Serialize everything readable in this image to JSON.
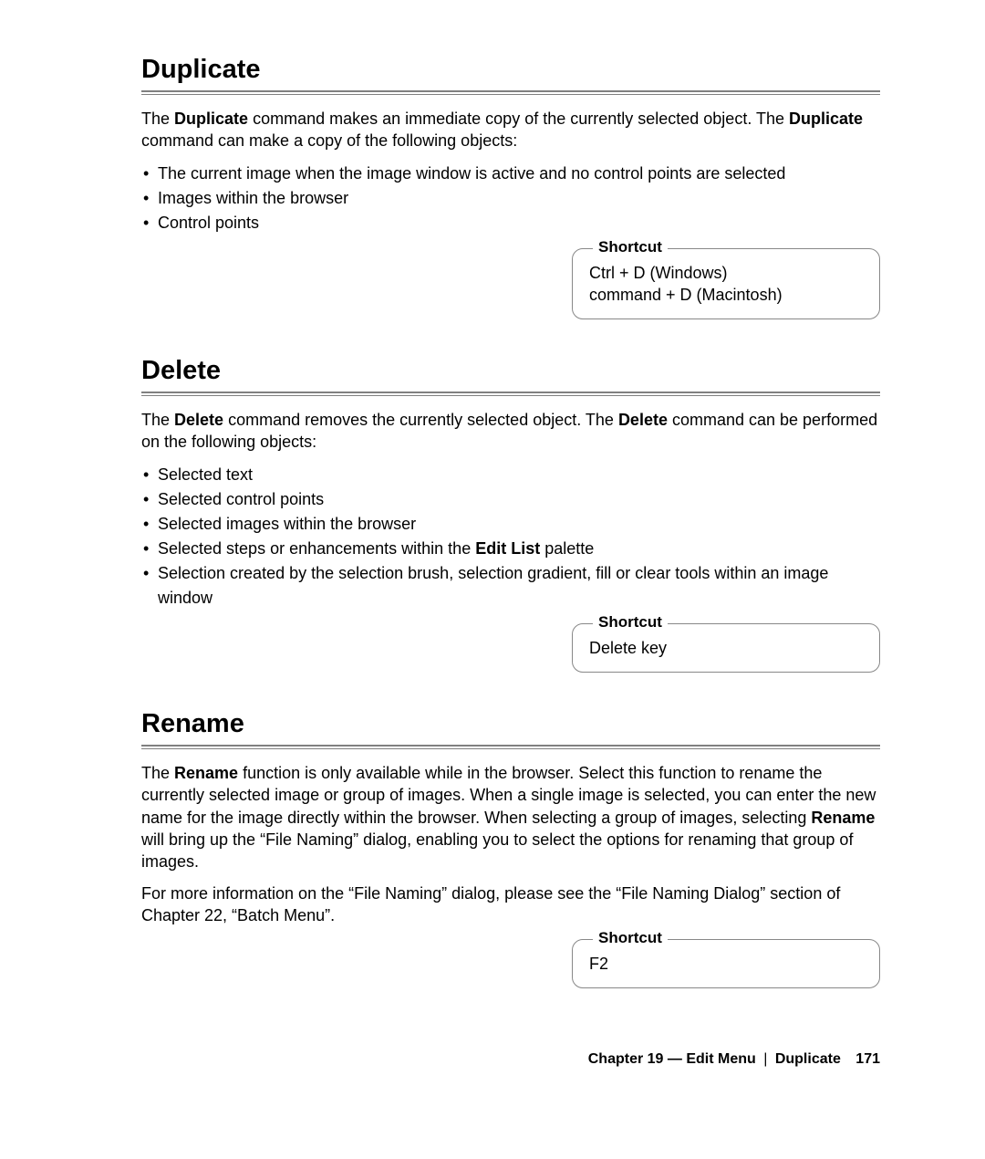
{
  "sections": {
    "duplicate": {
      "heading": "Duplicate",
      "intro_pre": "The ",
      "intro_bold1": "Duplicate",
      "intro_mid": " command makes an immediate copy of the currently selected object. The ",
      "intro_bold2": "Duplicate",
      "intro_post": " command can make a copy of the following objects:",
      "bullets": [
        "The current image when the image window is active and no control points are selected",
        "Images within the browser",
        "Control points"
      ],
      "shortcut_label": "Shortcut",
      "shortcut_line1": "Ctrl + D (Windows)",
      "shortcut_line2": "command + D (Macintosh)"
    },
    "delete": {
      "heading": "Delete",
      "intro_pre": "The ",
      "intro_bold1": "Delete",
      "intro_mid": " command removes the currently selected object. The ",
      "intro_bold2": "Delete",
      "intro_post": " command can be performed on the following objects:",
      "bullets_plain": [
        "Selected text",
        "Selected control points",
        "Selected images within the browser"
      ],
      "bullet4_pre": "Selected steps or enhancements within the ",
      "bullet4_bold": "Edit List",
      "bullet4_post": " palette",
      "bullet5": "Selection created by the selection brush, selection gradient, fill or clear tools within an image window",
      "shortcut_label": "Shortcut",
      "shortcut_line1": "Delete key"
    },
    "rename": {
      "heading": "Rename",
      "p1_pre": "The ",
      "p1_bold1": "Rename",
      "p1_mid": " function is only available while in the browser. Select this function to rename the currently selected image or group of images. When a single image is selected, you can enter the new name for the image directly within the browser. When selecting a group of images, selecting ",
      "p1_bold2": "Rename",
      "p1_post": " will bring up the “File Naming” dialog, enabling you to select the options for renaming that group of images.",
      "p2": "For more information on the “File Naming” dialog, please see the “File Naming Dialog” section of Chapter 22, “Batch Menu”.",
      "shortcut_label": "Shortcut",
      "shortcut_line1": "F2"
    }
  },
  "footer": {
    "chapter": "Chapter 19 — Edit Menu",
    "separator": "|",
    "topic": "Duplicate",
    "page": "171"
  }
}
